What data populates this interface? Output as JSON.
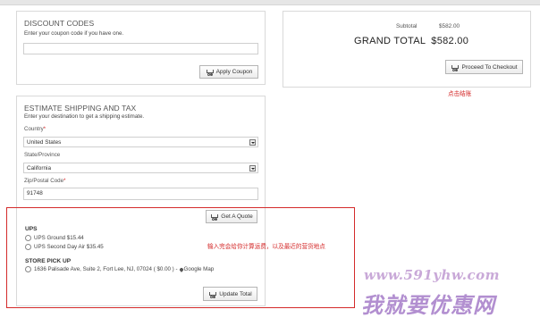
{
  "discount": {
    "title": "DISCOUNT CODES",
    "subtitle": "Enter your coupon code if you have one.",
    "coupon_value": "",
    "apply_label": "Apply Coupon"
  },
  "totals": {
    "subtotal_label": "Subtotal",
    "subtotal_value": "$582.00",
    "grand_label": "GRAND TOTAL",
    "grand_value": "$582.00",
    "checkout_label": "Proceed To Checkout"
  },
  "shipping": {
    "title": "ESTIMATE SHIPPING AND TAX",
    "subtitle": "Enter your destination to get a shipping estimate.",
    "country_label": "Country",
    "country_value": "United States",
    "state_label": "State/Province",
    "state_value": "California",
    "zip_label": "Zip/Postal Code",
    "zip_value": "91748",
    "required_mark": "*",
    "quote_label": "Get A Quote",
    "ups_heading": "UPS",
    "ups_ground": "UPS Ground $15.44",
    "ups_second_day": "UPS Second Day Air $35.45",
    "pickup_heading": "STORE PICK UP",
    "pickup_address": "1636 Palisade Ave, Suite 2, Fort Lee, NJ, 07024 ( $0.00 ) -",
    "pickup_map": "Google Map",
    "update_label": "Update Total"
  },
  "annotations": {
    "checkout_note": "点击结账",
    "shipping_note": "输入完会给你计算运费，以及最近的营货地点"
  },
  "watermark": {
    "url": "www.591yhw.com",
    "text": "我就要优惠网"
  },
  "colors": {
    "annotation_red": "#d42a2a",
    "panel_border": "#d9d9d9",
    "watermark_purple": "#b28fd0"
  },
  "icons": {
    "cart": "shopping-cart-icon",
    "select": "dropdown-arrow-icon",
    "radio": "radio-button-icon",
    "map": "map-pin-icon"
  }
}
